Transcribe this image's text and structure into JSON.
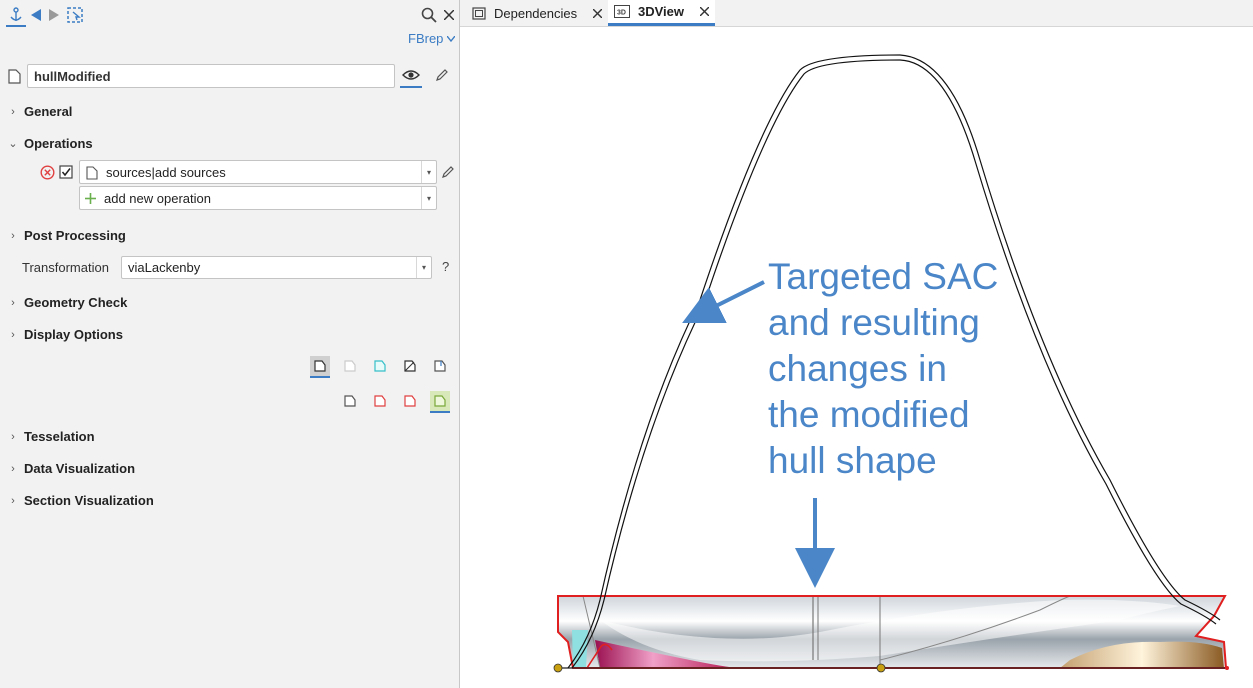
{
  "left_panel": {
    "filter_label": "FBrep",
    "object_name": "hullModified",
    "sections": {
      "general": "General",
      "operations": "Operations",
      "post_processing": "Post Processing",
      "geometry_check": "Geometry Check",
      "display_options": "Display Options",
      "tesselation": "Tesselation",
      "data_visualization": "Data Visualization",
      "section_visualization": "Section Visualization"
    },
    "operations": {
      "operation_value": "sources|add sources",
      "add_new": "add new operation"
    },
    "post_processing": {
      "transformation_label": "Transformation",
      "transformation_value": "viaLackenby",
      "help": "?"
    }
  },
  "tabs": [
    {
      "label": "Dependencies",
      "active": false
    },
    {
      "label": "3DView",
      "active": true
    }
  ],
  "viewport": {
    "annotation_lines": [
      "Targeted SAC",
      "and resulting",
      "changes in",
      "the modified",
      "hull shape"
    ],
    "annotation_color": "#4a86c8",
    "hull_outline_color": "#e02020"
  },
  "colors": {
    "accent": "#3b7cc4",
    "error": "#e04040",
    "add": "#6ab04c"
  }
}
